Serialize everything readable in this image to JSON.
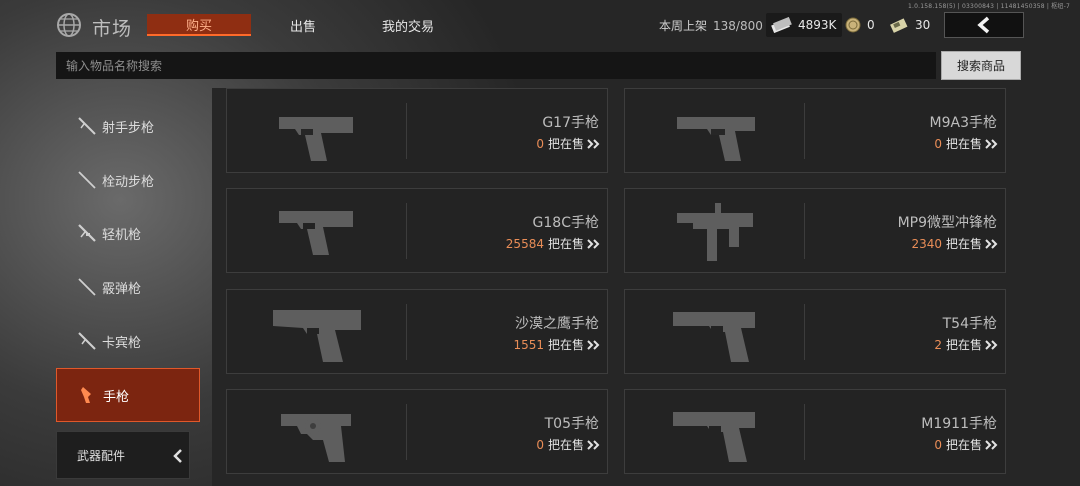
{
  "version_text": "1.0.158.158(5) | 03300843 | 11481450358 | 枢纽-7",
  "header": {
    "title": "市场",
    "tabs": [
      {
        "label": "购买",
        "active": true
      },
      {
        "label": "出售",
        "active": false
      },
      {
        "label": "我的交易",
        "active": false
      }
    ],
    "weekly_listing_label": "本周上架",
    "weekly_listing_value": "138/800",
    "currencies": [
      {
        "icon": "cash-icon",
        "value": "4893K"
      },
      {
        "icon": "coin-icon",
        "value": "0"
      },
      {
        "icon": "ticket-icon",
        "value": "30"
      }
    ],
    "back_icon": "chevron-left-icon"
  },
  "search": {
    "placeholder": "输入物品名称搜索",
    "button_label": "搜索商品"
  },
  "sidebar": {
    "items": [
      {
        "label": "射手步枪",
        "icon": "marksman-rifle-icon",
        "active": false
      },
      {
        "label": "栓动步枪",
        "icon": "bolt-rifle-icon",
        "active": false
      },
      {
        "label": "轻机枪",
        "icon": "lmg-icon",
        "active": false
      },
      {
        "label": "霰弹枪",
        "icon": "shotgun-icon",
        "active": false
      },
      {
        "label": "卡宾枪",
        "icon": "carbine-icon",
        "active": false
      },
      {
        "label": "手枪",
        "icon": "pistol-icon",
        "active": true
      }
    ],
    "accessory_label": "武器配件"
  },
  "main": {
    "category_title": "手枪",
    "on_sale_label": "把在售",
    "items": [
      {
        "name": "G17手枪",
        "count": "0",
        "icon": "glock-pistol-icon"
      },
      {
        "name": "M9A3手枪",
        "count": "0",
        "icon": "m9-pistol-icon"
      },
      {
        "name": "G18C手枪",
        "count": "25584",
        "icon": "glock-pistol-icon"
      },
      {
        "name": "MP9微型冲锋枪",
        "count": "2340",
        "icon": "mp9-smg-icon"
      },
      {
        "name": "沙漠之鹰手枪",
        "count": "1551",
        "icon": "deagle-pistol-icon"
      },
      {
        "name": "T54手枪",
        "count": "2",
        "icon": "t54-pistol-icon"
      },
      {
        "name": "T05手枪",
        "count": "0",
        "icon": "revolver-icon"
      },
      {
        "name": "M1911手枪",
        "count": "0",
        "icon": "m1911-pistol-icon"
      }
    ]
  },
  "colors": {
    "accent_orange": "#e98d57",
    "active_tab_bg": "#8f2e12",
    "active_sidebar_bg": "#7c2510"
  }
}
